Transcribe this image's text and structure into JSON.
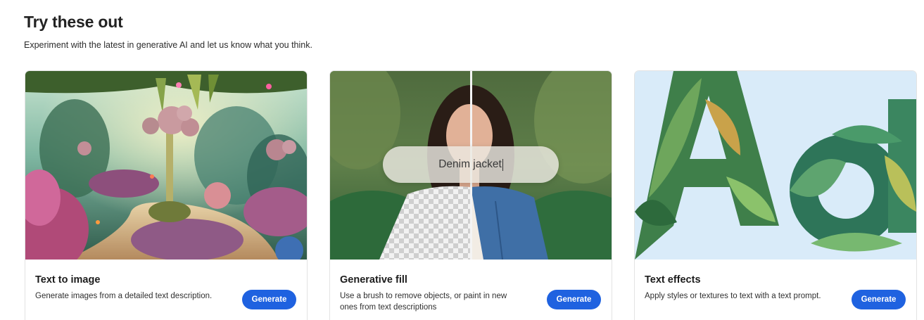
{
  "header": {
    "title": "Try these out",
    "subtitle": "Experiment with the latest in generative AI and let us know what you think."
  },
  "cards": [
    {
      "title": "Text to image",
      "description": "Generate images from a detailed text description.",
      "button_label": "Generate",
      "image": "fantasy-garden-illustration"
    },
    {
      "title": "Generative fill",
      "description": "Use a brush to remove objects, or paint in new ones from text descriptions",
      "button_label": "Generate",
      "image": "portrait-denim-jacket-before-after",
      "prompt_text": "Denim jacket"
    },
    {
      "title": "Text effects",
      "description": "Apply styles or textures to text with a text prompt.",
      "button_label": "Generate",
      "image": "leafy-letters-Aa"
    }
  ],
  "colors": {
    "button": "#1f62e0",
    "card_border": "#e3e3e3",
    "text_effects_bg": "#d9ebf9"
  }
}
